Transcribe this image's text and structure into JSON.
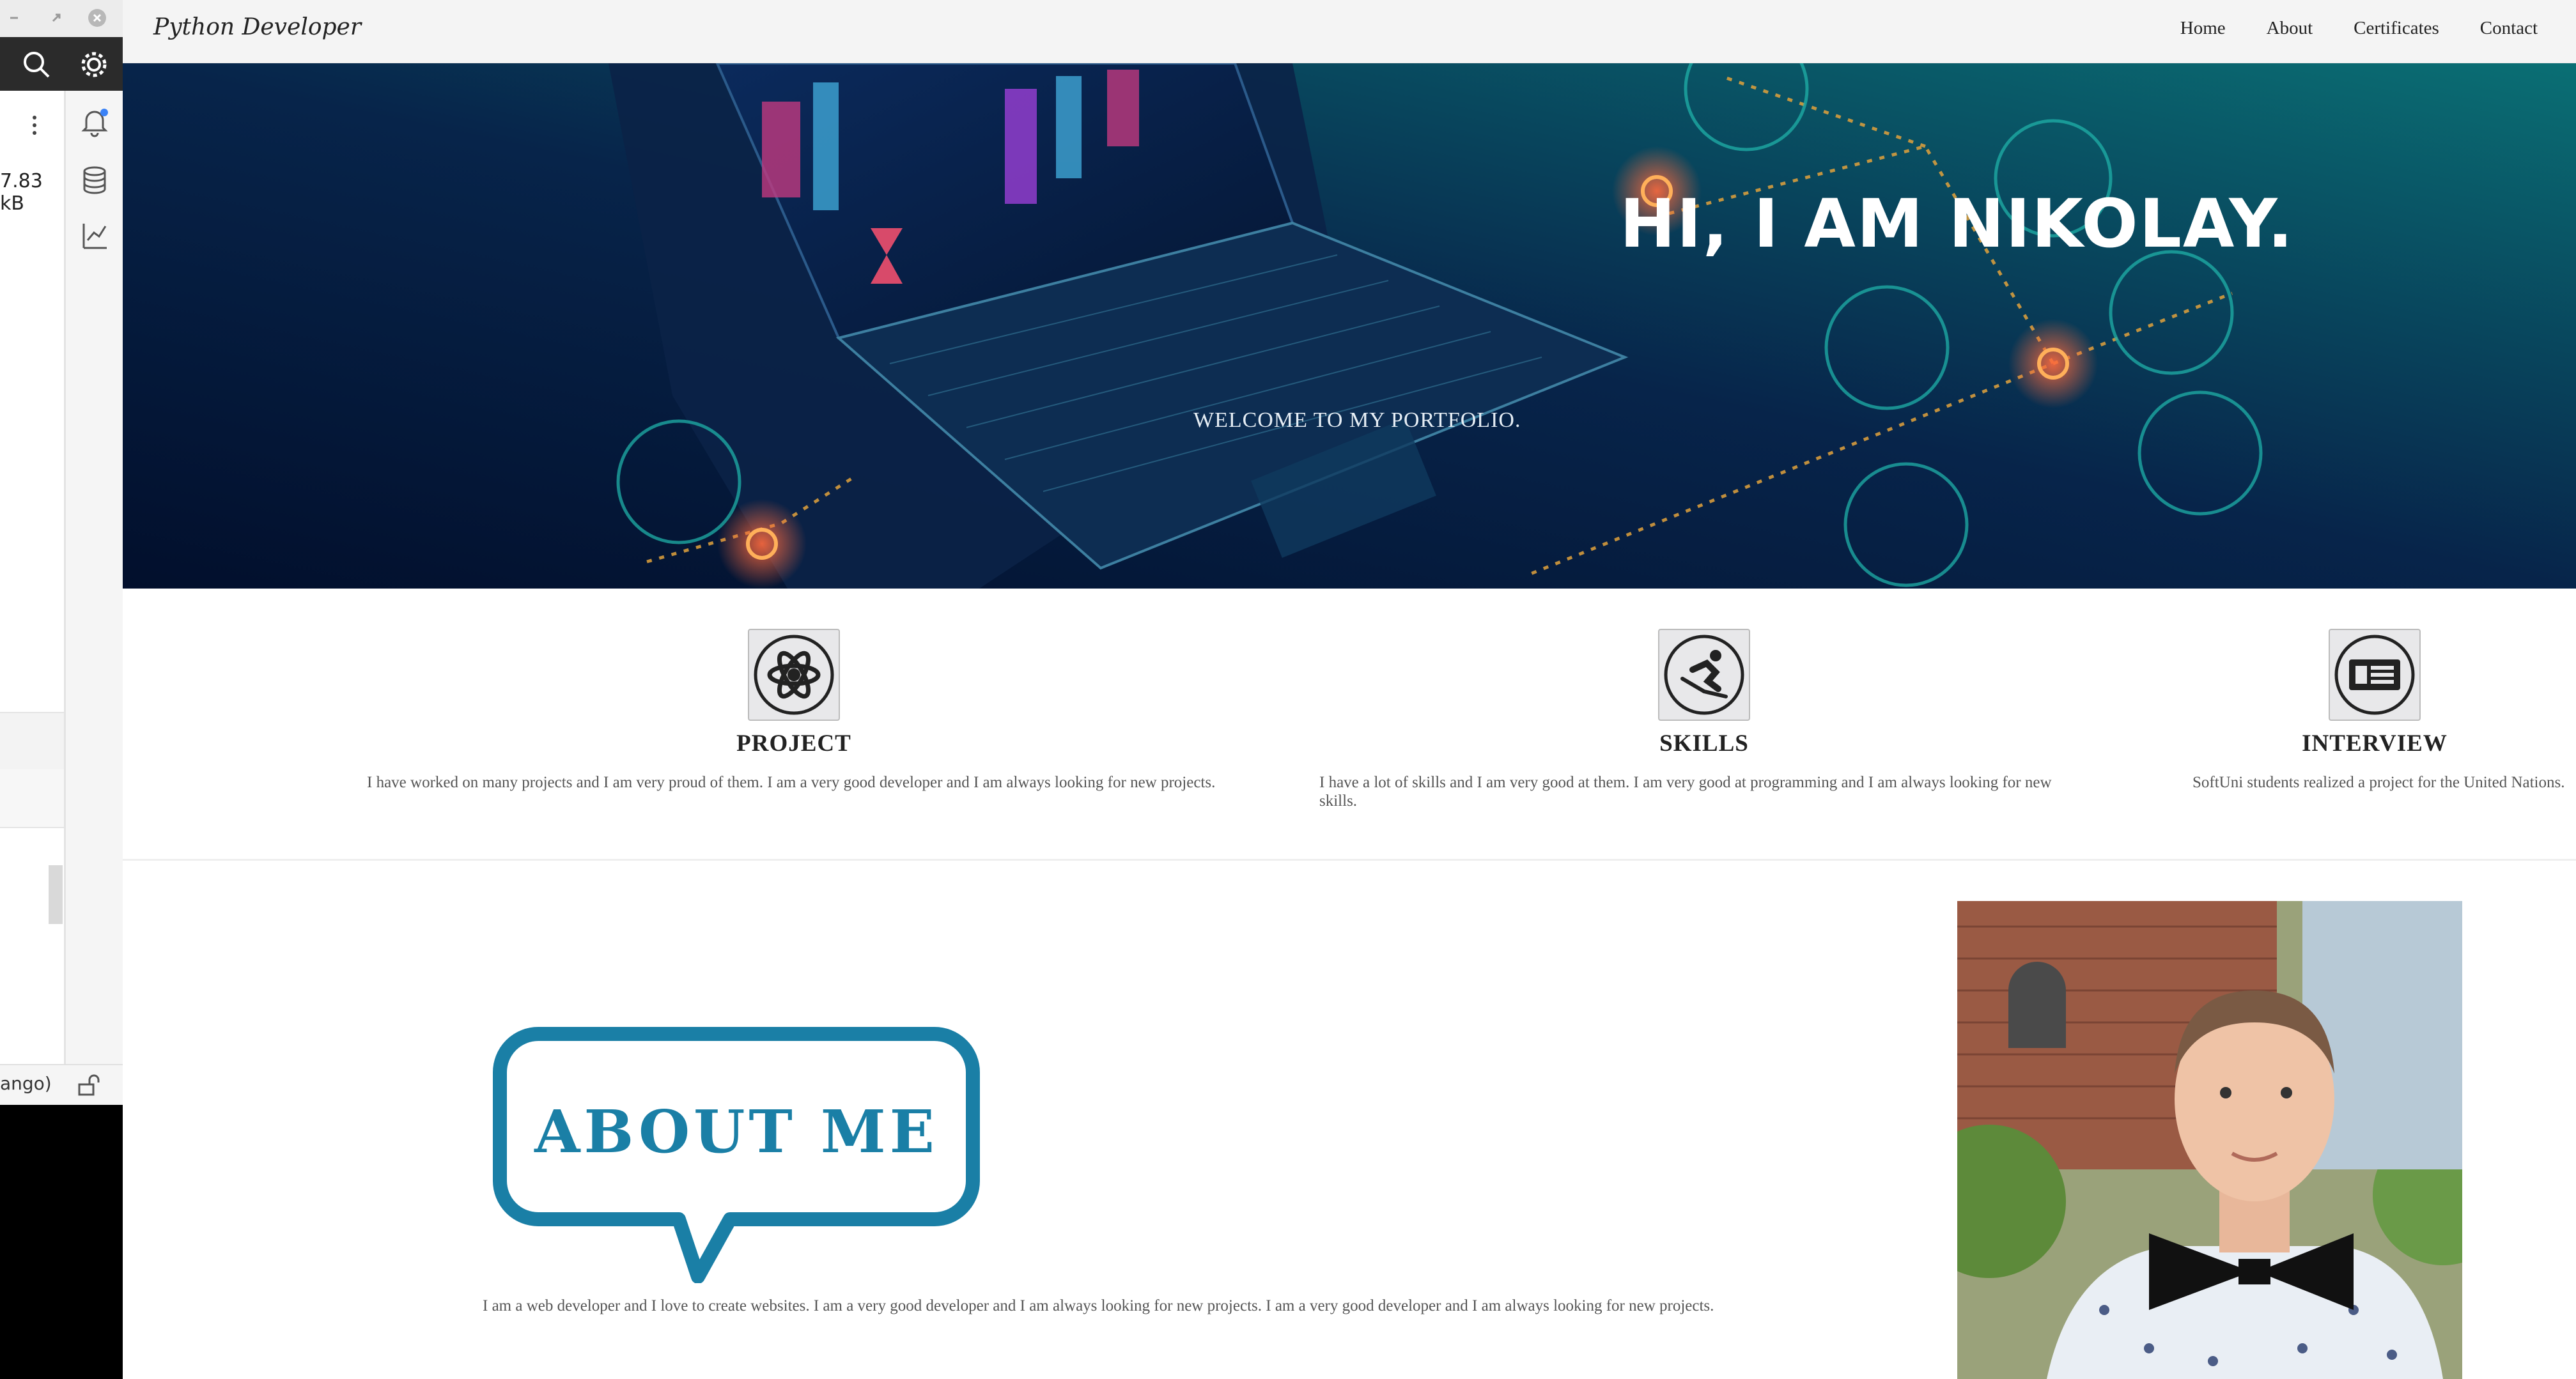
{
  "ide": {
    "file_size": "7.83 kB",
    "status_text": "ango)",
    "icons": [
      "minimize-icon",
      "maximize-icon",
      "close-icon",
      "search-icon",
      "gear-icon",
      "kebab-menu-icon",
      "bell-icon",
      "database-icon",
      "chart-icon",
      "unlock-icon"
    ]
  },
  "nav": {
    "brand": "Python Developer",
    "links": [
      "Home",
      "About",
      "Certificates",
      "Contact"
    ]
  },
  "hero": {
    "title": "HI, I AM NIKOLAY.",
    "subtitle": "WELCOME TO MY PORTFOLIO."
  },
  "features": [
    {
      "title": "PROJECT",
      "icon": "atom-icon",
      "text": "I have worked on many projects and I am very proud of them. I am a very good developer and I am always looking for new projects."
    },
    {
      "title": "SKILLS",
      "icon": "skier-icon",
      "text": "I have a lot of skills and I am very good at them. I am very good at programming and I am always looking for new skills."
    },
    {
      "title": "INTERVIEW",
      "icon": "newspaper-icon",
      "text": "SoftUni students realized a project for the United Nations."
    }
  ],
  "about": {
    "badge": "ABOUT ME",
    "text": "I am a web developer and I love to create websites. I am a very good developer and I am always looking for new projects. I am a very good developer and I am always looking for new projects."
  },
  "colors": {
    "hero_dark": "#061a3a",
    "hero_teal": "#0b6f73",
    "about_blue": "#1a7fa6",
    "nav_bg": "#f4f4f4"
  }
}
